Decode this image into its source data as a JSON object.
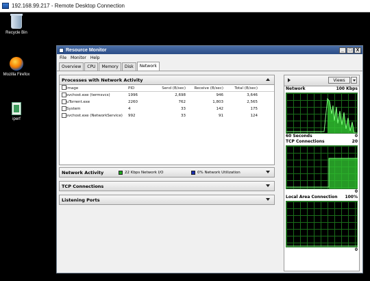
{
  "rdp": {
    "title": "192.168.99.217 - Remote Desktop Connection"
  },
  "desktop": {
    "icons": [
      {
        "label": "Recycle Bin",
        "icon": "recycle-bin-icon"
      },
      {
        "label": "Mozilla Firefox",
        "icon": "firefox-icon"
      },
      {
        "label": "iperf",
        "icon": "iperf-icon"
      }
    ]
  },
  "window": {
    "title": "Resource Monitor",
    "controls": [
      "_",
      "□",
      "X"
    ],
    "menu": [
      "File",
      "Monitor",
      "Help"
    ],
    "tabs": [
      "Overview",
      "CPU",
      "Memory",
      "Disk",
      "Network"
    ],
    "active_tab": "Network"
  },
  "processes": {
    "title": "Processes with Network Activity",
    "columns": [
      "Image",
      "PID",
      "Send (B/sec)",
      "Receive (B/sec)",
      "Total (B/sec)"
    ],
    "rows": [
      {
        "image": "svchost.exe (termsvcs)",
        "pid": "1996",
        "send": "2,698",
        "receive": "946",
        "total": "3,646"
      },
      {
        "image": "uTorrent.exe",
        "pid": "2260",
        "send": "762",
        "receive": "1,803",
        "total": "2,565"
      },
      {
        "image": "System",
        "pid": "4",
        "send": "33",
        "receive": "142",
        "total": "175"
      },
      {
        "image": "svchost.exe (NetworkService)",
        "pid": "992",
        "send": "33",
        "receive": "91",
        "total": "124"
      }
    ]
  },
  "network_activity": {
    "title": "Network Activity",
    "io_label": "22 Kbps Network I/O",
    "util_label": "0% Network Utilization",
    "io_color": "#1fa71f",
    "util_color": "#1a2fb0"
  },
  "sections": {
    "tcp": "TCP Connections",
    "listening": "Listening Ports"
  },
  "side": {
    "views_label": "Views",
    "graphs": [
      {
        "title": "Network",
        "max": "100 Kbps",
        "foot_left": "60 Seconds",
        "foot_right": "0"
      },
      {
        "title": "TCP Connections",
        "max": "20",
        "foot_left": "",
        "foot_right": "0"
      },
      {
        "title": "Local Area Connection",
        "max": "100%",
        "foot_left": "",
        "foot_right": "0"
      }
    ]
  }
}
